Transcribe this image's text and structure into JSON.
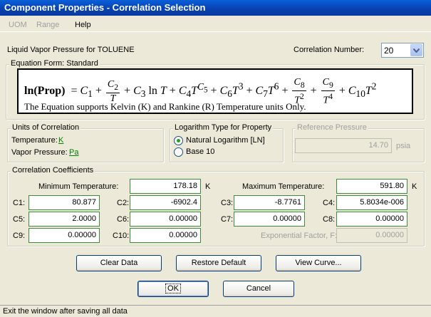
{
  "window": {
    "title": "Component Properties - Correlation Selection"
  },
  "menu": {
    "items": [
      {
        "label": "UOM",
        "enabled": false
      },
      {
        "label": "Range",
        "enabled": false
      },
      {
        "label": "Help",
        "enabled": true
      }
    ]
  },
  "header": {
    "property_label": "Liquid Vapor Pressure for TOLUENE",
    "correlation_number_label": "Correlation Number:",
    "correlation_number_value": "20"
  },
  "equation": {
    "group_title": "Equation Form: Standard",
    "note": "The Equation supports Kelvin (K) and Rankine (R) Temperature units Only."
  },
  "units": {
    "group_title": "Units of Correlation",
    "temperature_label": "Temperature:",
    "temperature_value": "K",
    "vapor_pressure_label": "Vapor Pressure:",
    "vapor_pressure_value": "Pa"
  },
  "logarithm": {
    "group_title": "Logarithm Type for Property",
    "options": [
      {
        "label": "Natural Logarithm [LN]",
        "selected": true
      },
      {
        "label": "Base 10",
        "selected": false
      }
    ]
  },
  "reference_pressure": {
    "group_title": "Reference Pressure",
    "value": "14.70",
    "unit": "psia"
  },
  "coefficients": {
    "group_title": "Correlation  Coefficients",
    "min_temp_label": "Minimum Temperature:",
    "min_temp_value": "178.18",
    "min_temp_unit": "K",
    "max_temp_label": "Maximum Temperature:",
    "max_temp_value": "591.80",
    "max_temp_unit": "K",
    "c1_label": "C1:",
    "c1_value": "80.877",
    "c2_label": "C2:",
    "c2_value": "-6902.4",
    "c3_label": "C3:",
    "c3_value": "-8.7761",
    "c4_label": "C4:",
    "c4_value": "5.8034e-006",
    "c5_label": "C5:",
    "c5_value": "2.0000",
    "c6_label": "C6:",
    "c6_value": "0.00000",
    "c7_label": "C7:",
    "c7_value": "0.00000",
    "c8_label": "C8:",
    "c8_value": "0.00000",
    "c9_label": "C9:",
    "c9_value": "0.00000",
    "c10_label": "C10:",
    "c10_value": "0.00000",
    "exp_factor_label": "Exponential Factor, F:",
    "exp_factor_value": "0.00000"
  },
  "buttons": {
    "clear_data": "Clear Data",
    "restore_default": "Restore Default",
    "view_curve": "View Curve...",
    "ok": "OK",
    "cancel": "Cancel"
  },
  "status": {
    "text": "Exit the window after saving all data"
  }
}
